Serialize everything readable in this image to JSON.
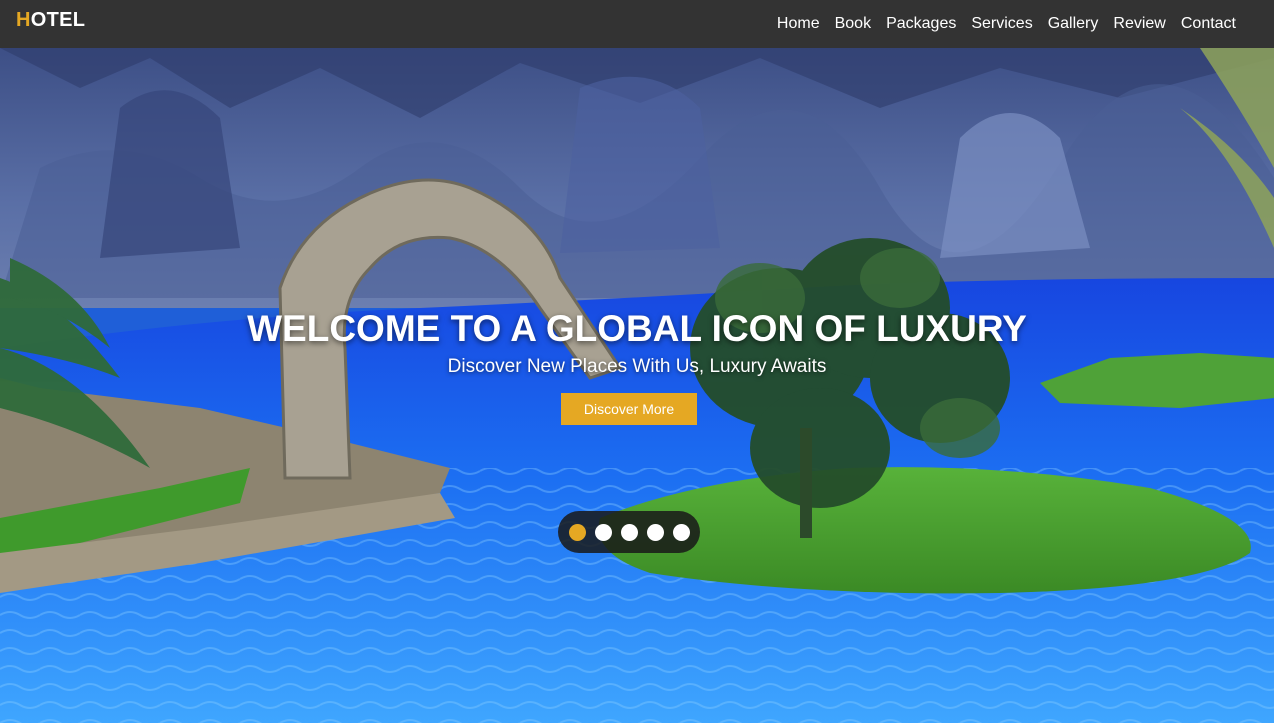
{
  "brand": {
    "first_letter": "H",
    "rest": "OTEL",
    "accent_color": "#e5a823"
  },
  "nav": {
    "items": [
      {
        "label": "Home"
      },
      {
        "label": "Book"
      },
      {
        "label": "Packages"
      },
      {
        "label": "Services"
      },
      {
        "label": "Gallery"
      },
      {
        "label": "Review"
      },
      {
        "label": "Contact"
      }
    ]
  },
  "hero": {
    "title": "WELCOME TO A GLOBAL ICON OF LUXURY",
    "subtitle": "Discover New Places With Us, Luxury Awaits",
    "cta_label": "Discover More",
    "background": "resort pool with rock wall, palms and grass island",
    "slides": {
      "count": 5,
      "active_index": 0
    }
  },
  "colors": {
    "navbar": "#333333",
    "accent": "#e5a823",
    "pool": "#1f6ff0"
  }
}
